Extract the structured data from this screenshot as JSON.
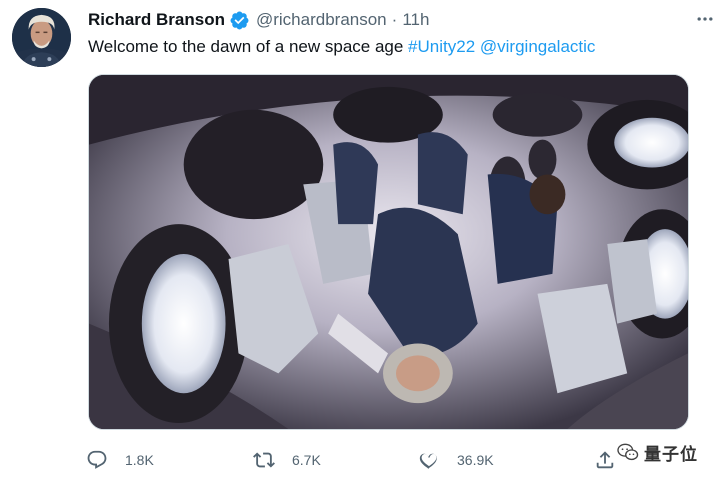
{
  "author": {
    "name": "Richard Branson",
    "handle": "@richardbranson",
    "separator": "·",
    "time": "11h",
    "verified": true
  },
  "tweet": {
    "text": "Welcome to the dawn of a new space age ",
    "hashtag": "#Unity22",
    "space": " ",
    "mention": "@virgingalactic"
  },
  "media": {
    "alt": "Crew floating in zero gravity inside spacecraft cabin"
  },
  "actions": {
    "reply_count": "1.8K",
    "retweet_count": "6.7K",
    "like_count": "36.9K"
  },
  "watermark": {
    "text": "量子位"
  },
  "colors": {
    "link": "#1d9bf0",
    "secondary_text": "#536471",
    "primary_text": "#0f1419",
    "verified_badge": "#1d9bf0"
  }
}
